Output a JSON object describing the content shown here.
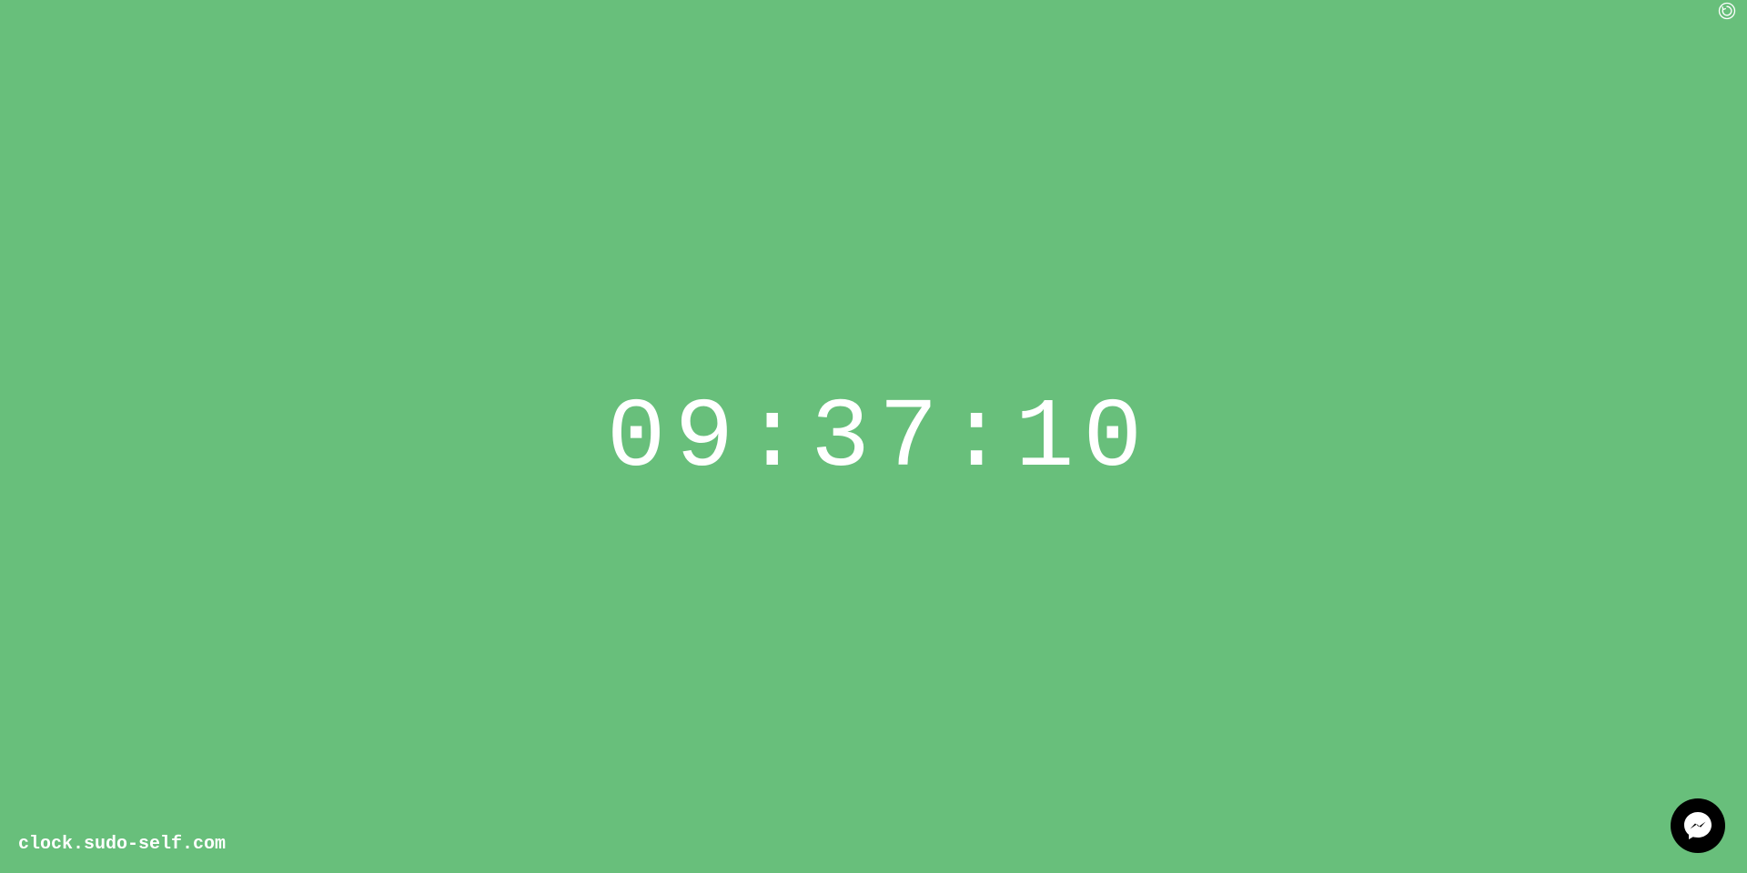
{
  "clock": {
    "time": "09:37:10"
  },
  "footer": {
    "site": "clock.sudo-self.com"
  },
  "icons": {
    "top_right": "refresh-icon",
    "bottom_right": "messenger-icon"
  },
  "colors": {
    "background": "#68bf7b",
    "text": "#ffffff",
    "chat_button": "#000000"
  }
}
